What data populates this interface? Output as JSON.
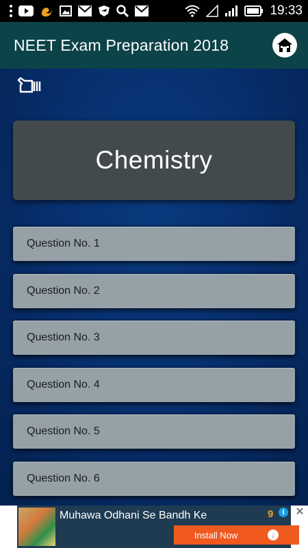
{
  "status_bar": {
    "time": "19:33",
    "icons": [
      "more-vert-icon",
      "youtube-icon",
      "uc-browser-icon",
      "image-icon",
      "gmail-icon",
      "shield-icon",
      "search-icon",
      "gmail-icon",
      "wifi-icon",
      "signal-empty-icon",
      "signal-icon",
      "battery-icon"
    ]
  },
  "app_bar": {
    "title": "NEET Exam Preparation 2018",
    "home_icon": "home-icon"
  },
  "content": {
    "back_icon": "hand-pointing-icon",
    "subject": "Chemistry",
    "questions": [
      "Question No. 1",
      "Question No. 2",
      "Question No. 3",
      "Question No. 4",
      "Question No. 5",
      "Question No. 6"
    ]
  },
  "ad": {
    "title": "Muhawa Odhani Se Bandh Ke",
    "badge": "9",
    "info": "i",
    "close": "✕",
    "install_label": "Install Now"
  },
  "colors": {
    "app_bar": "#0c4348",
    "content_bg": "#06285c",
    "subject_card": "#434a4e",
    "question_item": "#95a1a6",
    "install_button": "#f05a1e"
  }
}
